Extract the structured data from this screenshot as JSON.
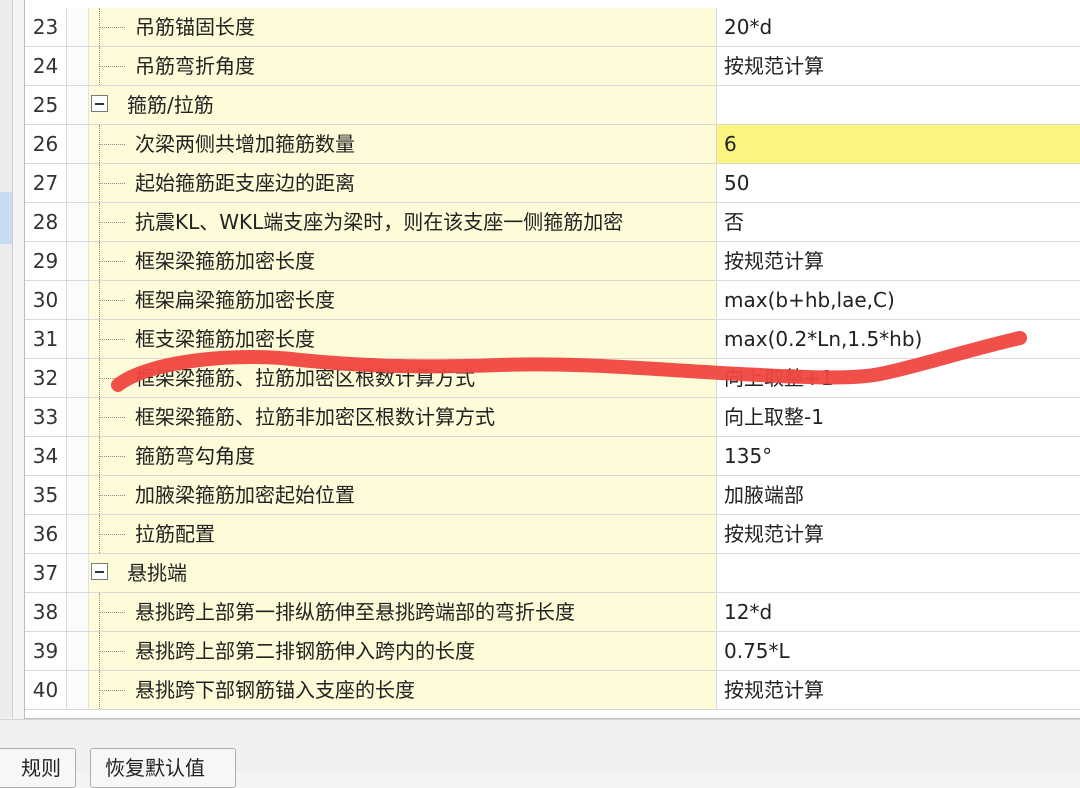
{
  "rows": [
    {
      "num": "23",
      "name": "吊筋锚固长度",
      "value": "20*d",
      "group": false
    },
    {
      "num": "24",
      "name": "吊筋弯折角度",
      "value": "按规范计算",
      "group": false
    },
    {
      "num": "25",
      "name": "箍筋/拉筋",
      "value": "",
      "group": true
    },
    {
      "num": "26",
      "name": "次梁两侧共增加箍筋数量",
      "value": "6",
      "group": false,
      "highlight": true
    },
    {
      "num": "27",
      "name": "起始箍筋距支座边的距离",
      "value": "50",
      "group": false
    },
    {
      "num": "28",
      "name": "抗震KL、WKL端支座为梁时，则在该支座一侧箍筋加密",
      "value": "否",
      "group": false
    },
    {
      "num": "29",
      "name": "框架梁箍筋加密长度",
      "value": "按规范计算",
      "group": false
    },
    {
      "num": "30",
      "name": "框架扁梁箍筋加密长度",
      "value": "max(b+hb,lae,C)",
      "group": false
    },
    {
      "num": "31",
      "name": "框支梁箍筋加密长度",
      "value": "max(0.2*Ln,1.5*hb)",
      "group": false
    },
    {
      "num": "32",
      "name": "框架梁箍筋、拉筋加密区根数计算方式",
      "value": "向上取整+1",
      "group": false
    },
    {
      "num": "33",
      "name": "框架梁箍筋、拉筋非加密区根数计算方式",
      "value": "向上取整-1",
      "group": false
    },
    {
      "num": "34",
      "name": "箍筋弯勾角度",
      "value": "135°",
      "group": false
    },
    {
      "num": "35",
      "name": "加腋梁箍筋加密起始位置",
      "value": "加腋端部",
      "group": false
    },
    {
      "num": "36",
      "name": "拉筋配置",
      "value": "按规范计算",
      "group": false
    },
    {
      "num": "37",
      "name": "悬挑端",
      "value": "",
      "group": true
    },
    {
      "num": "38",
      "name": "悬挑跨上部第一排纵筋伸至悬挑跨端部的弯折长度",
      "value": "12*d",
      "group": false
    },
    {
      "num": "39",
      "name": "悬挑跨上部第二排钢筋伸入跨内的长度",
      "value": "0.75*L",
      "group": false
    },
    {
      "num": "40",
      "name": "悬挑跨下部钢筋锚入支座的长度",
      "value": "按规范计算",
      "group": false
    }
  ],
  "buttons": {
    "rules": "规则",
    "restore": "恢复默认值"
  },
  "colors": {
    "name_cell_bg": "#fdfbd8",
    "highlight_bg": "#fbf580",
    "annotation_stroke": "#f0463f"
  }
}
